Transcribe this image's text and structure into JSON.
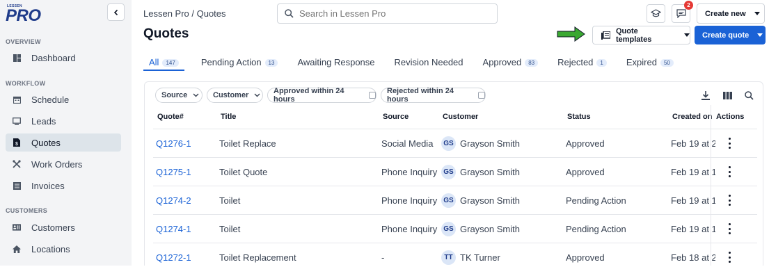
{
  "brand": {
    "logo_small": "LESSEN",
    "logo_big": "PRO"
  },
  "sidebar": {
    "sections": [
      {
        "title": "OVERVIEW",
        "items": [
          {
            "label": "Dashboard",
            "icon": "dashboard-icon"
          }
        ]
      },
      {
        "title": "WORKFLOW",
        "items": [
          {
            "label": "Schedule",
            "icon": "calendar-icon"
          },
          {
            "label": "Leads",
            "icon": "monitor-icon"
          },
          {
            "label": "Quotes",
            "icon": "quote-document-icon",
            "active": true
          },
          {
            "label": "Work Orders",
            "icon": "tools-icon"
          },
          {
            "label": "Invoices",
            "icon": "invoice-icon"
          }
        ]
      },
      {
        "title": "CUSTOMERS",
        "items": [
          {
            "label": "Customers",
            "icon": "contact-card-icon"
          },
          {
            "label": "Locations",
            "icon": "home-icon"
          }
        ]
      }
    ]
  },
  "header": {
    "breadcrumb": "Lessen Pro / Quotes",
    "title": "Quotes",
    "search_placeholder": "Search in Lessen Pro",
    "notifications_count": "2",
    "create_new_label": "Create new",
    "quote_templates_label": "Quote templates",
    "create_quote_label": "Create quote"
  },
  "tabs": [
    {
      "label": "All",
      "count": "147",
      "active": true
    },
    {
      "label": "Pending Action",
      "count": "13"
    },
    {
      "label": "Awaiting Response",
      "count": ""
    },
    {
      "label": "Revision Needed",
      "count": ""
    },
    {
      "label": "Approved",
      "count": "83"
    },
    {
      "label": "Rejected",
      "count": "1"
    },
    {
      "label": "Expired",
      "count": "50"
    }
  ],
  "filters": {
    "source": "Source",
    "customer": "Customer",
    "approved_24": "Approved within 24 hours",
    "rejected_24": "Rejected within 24 hours"
  },
  "table": {
    "columns": [
      "Quote#",
      "Title",
      "Source",
      "Customer",
      "Status",
      "Created on",
      "Actions"
    ],
    "rows": [
      {
        "id": "Q1276-1",
        "title": "Toilet Replace",
        "source": "Social Media",
        "initials": "GS",
        "customer": "Grayson Smith",
        "status": "Approved",
        "created": "Feb 19 at 2"
      },
      {
        "id": "Q1275-1",
        "title": "Toilet Quote",
        "source": "Phone Inquiry",
        "initials": "GS",
        "customer": "Grayson Smith",
        "status": "Approved",
        "created": "Feb 19 at 1:"
      },
      {
        "id": "Q1274-2",
        "title": "Toilet",
        "source": "Phone Inquiry",
        "initials": "GS",
        "customer": "Grayson Smith",
        "status": "Pending Action",
        "created": "Feb 19 at 1:"
      },
      {
        "id": "Q1274-1",
        "title": "Toilet",
        "source": "Phone Inquiry",
        "initials": "GS",
        "customer": "Grayson Smith",
        "status": "Pending Action",
        "created": "Feb 19 at 1:"
      },
      {
        "id": "Q1272-1",
        "title": "Toilet Replacement",
        "source": "-",
        "initials": "TT",
        "customer": "TK Turner",
        "status": "Approved",
        "created": "Feb 18 at 2"
      }
    ]
  },
  "colors": {
    "primary": "#1a62d6",
    "brand": "#1f3b8a",
    "arrow": "#3aa831",
    "badge": "#e53935",
    "sidebar_bg": "#f3f4f6",
    "active_nav": "#dde4ea"
  }
}
